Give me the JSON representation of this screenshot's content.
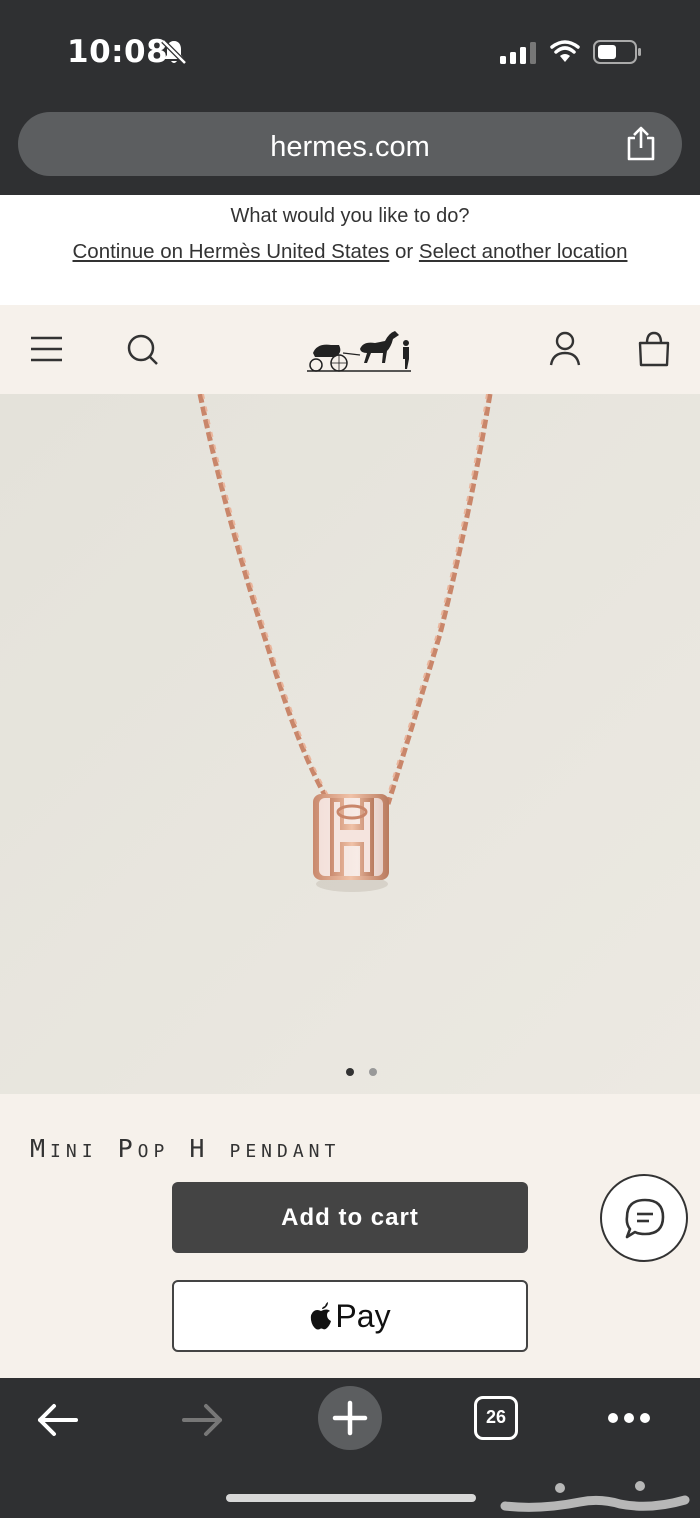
{
  "status_bar": {
    "time": "10:08",
    "icons": [
      "bell-slash-icon",
      "signal-icon",
      "wifi-icon",
      "battery-icon"
    ]
  },
  "browser": {
    "url": "hermes.com",
    "share_icon": "share-icon"
  },
  "location_banner": {
    "question": "What would you like to do?",
    "continue_link": "Continue on Hermès United States",
    "or_text": "or",
    "select_link": "Select another location"
  },
  "site_header": {
    "icons": [
      "menu-icon",
      "search-icon",
      "hermes-carriage-logo",
      "account-icon",
      "shopping-bag-icon"
    ]
  },
  "product": {
    "name": "Mini Pop H pendant",
    "image_dots": {
      "count": 2,
      "active_index": 0
    },
    "add_to_cart_label": "Add to cart",
    "apple_pay_label": "Pay",
    "chat_icon": "chat-bubble-icon"
  },
  "toolbar": {
    "tab_count": "26",
    "icons": [
      "back-arrow-icon",
      "forward-arrow-icon",
      "new-tab-plus-icon",
      "tabs-icon",
      "more-dots-icon"
    ]
  },
  "colors": {
    "chrome": "#2f3032",
    "url_bar": "#5c5e60",
    "header_bg": "#f6f1eb",
    "product_bg": "#e8e5dd",
    "button_dark": "#444444",
    "rose_gold": "#d9a48a",
    "enamel_pink": "#f0dcd6"
  }
}
